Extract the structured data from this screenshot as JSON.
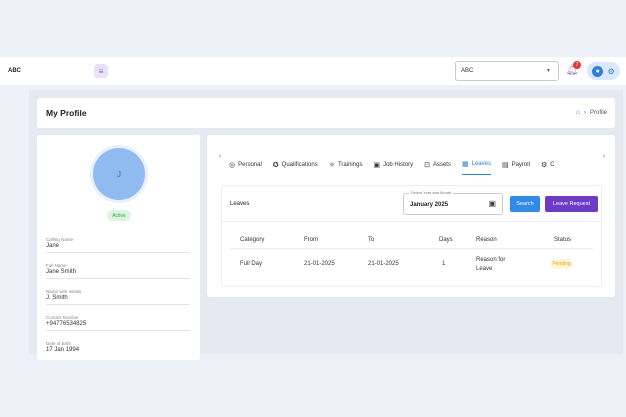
{
  "topbar": {
    "brand": "ABC",
    "menu_icon": "hamburger-icon",
    "company": "ABC",
    "notification_count": "7"
  },
  "header": {
    "title": "My Profile",
    "breadcrumb": "Profile"
  },
  "profile": {
    "initial": "J",
    "status": "Active",
    "fields": [
      {
        "label": "Calling Name",
        "value": "Jane"
      },
      {
        "label": "Full Name",
        "value": "Jane Smith"
      },
      {
        "label": "Name with Initials",
        "value": "J. Smith"
      },
      {
        "label": "Contact Number",
        "value": "+94776534825"
      },
      {
        "label": "Date of Birth",
        "value": "17 Jan 1994"
      }
    ]
  },
  "tabs": [
    {
      "label": "Personal",
      "icon": "user-circle-icon"
    },
    {
      "label": "Qualifications",
      "icon": "award-icon"
    },
    {
      "label": "Trainings",
      "icon": "atom-icon"
    },
    {
      "label": "Job History",
      "icon": "briefcase-icon"
    },
    {
      "label": "Assets",
      "icon": "lock-icon"
    },
    {
      "label": "Leaves",
      "icon": "calendar-icon",
      "active": true
    },
    {
      "label": "Payroll",
      "icon": "document-icon"
    },
    {
      "label": "C",
      "icon": "gear-icon"
    }
  ],
  "leaves": {
    "title": "Leaves",
    "month_legend": "Select Year and Month",
    "month_value": "January 2025",
    "search_label": "Search",
    "request_label": "Leave Request",
    "columns": [
      "Category",
      "From",
      "To",
      "Days",
      "Reason",
      "Status"
    ],
    "rows": [
      {
        "category": "Full Day",
        "from": "21-01-2025",
        "to": "21-01-2025",
        "days": "1",
        "reason": "Reason for Leave",
        "status": "Pending"
      }
    ]
  }
}
